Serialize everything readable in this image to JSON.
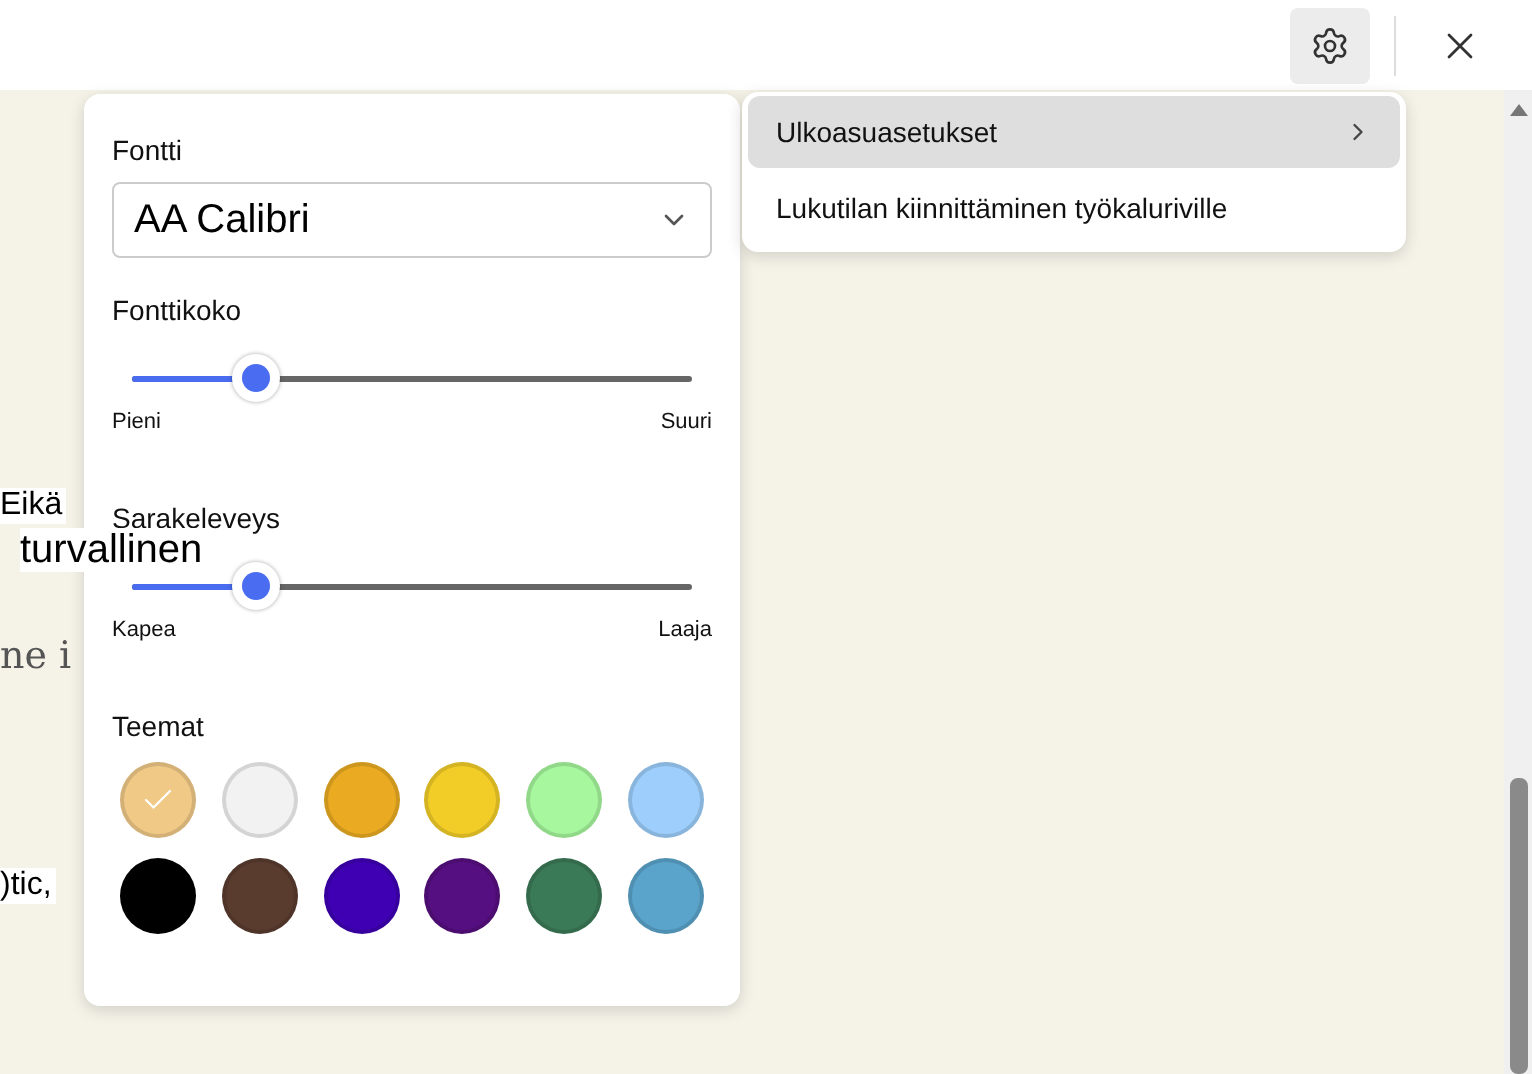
{
  "background_text": [
    {
      "text": "Eikä",
      "kind": "sans"
    },
    {
      "text": "turvallinen",
      "kind": "large"
    },
    {
      "text": "ne i",
      "kind": "serif"
    },
    {
      "text": ")tic,",
      "kind": "sans"
    }
  ],
  "appearance_panel": {
    "font_label": "Fontti",
    "font_value": "AA Calibri",
    "sliders": [
      {
        "label": "Fonttikoko",
        "level": 0.22,
        "min_label": "Pieni",
        "max_label": "Suuri"
      },
      {
        "label": "Sarakeleveys",
        "level": 0.22,
        "min_label": "Kapea",
        "max_label": "Laaja"
      }
    ],
    "themes_label": "Teemat",
    "themes": [
      {
        "color": "#f0c987",
        "selected": true
      },
      {
        "color": "#f2f2f2",
        "selected": false
      },
      {
        "color": "#eaab22",
        "selected": false
      },
      {
        "color": "#f2cd27",
        "selected": false
      },
      {
        "color": "#a6f79d",
        "selected": false
      },
      {
        "color": "#9dcefc",
        "selected": false
      },
      {
        "color": "#000000",
        "selected": false
      },
      {
        "color": "#5a3c2f",
        "selected": false
      },
      {
        "color": "#3f00b4",
        "selected": false
      },
      {
        "color": "#560f80",
        "selected": false
      },
      {
        "color": "#3b7a57",
        "selected": false
      },
      {
        "color": "#5aa4cb",
        "selected": false
      }
    ]
  },
  "settings_menu": [
    {
      "label": "Ulkoasuasetukset",
      "selected": true,
      "submenu": true
    },
    {
      "label": "Lukutilan kiinnittäminen työkaluriville",
      "selected": false,
      "submenu": false
    }
  ]
}
